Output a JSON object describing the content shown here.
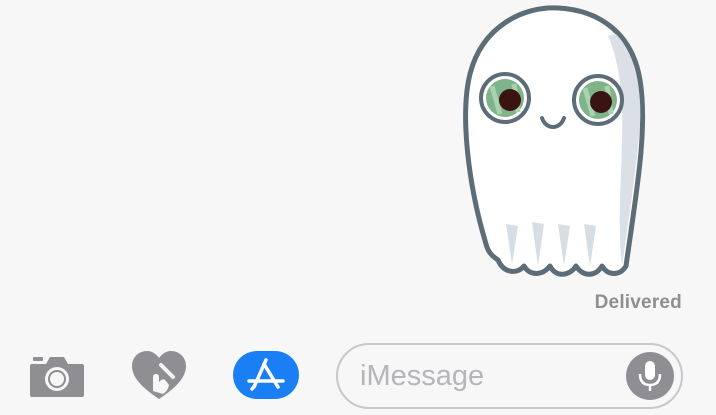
{
  "conversation": {
    "sticker": {
      "name": "ghost-sticker"
    },
    "status": "Delivered"
  },
  "toolbar": {
    "camera_icon": "camera-icon",
    "digital_touch_icon": "digital-touch-heart-icon",
    "app_store_icon": "app-store-icon",
    "message_input": {
      "placeholder": "iMessage",
      "value": ""
    },
    "mic_icon": "microphone-icon"
  },
  "colors": {
    "background": "#f7f7f7",
    "icon_gray": "#8e8e93",
    "accent_blue": "#1a7ff5",
    "status_text": "#8e8e93"
  }
}
